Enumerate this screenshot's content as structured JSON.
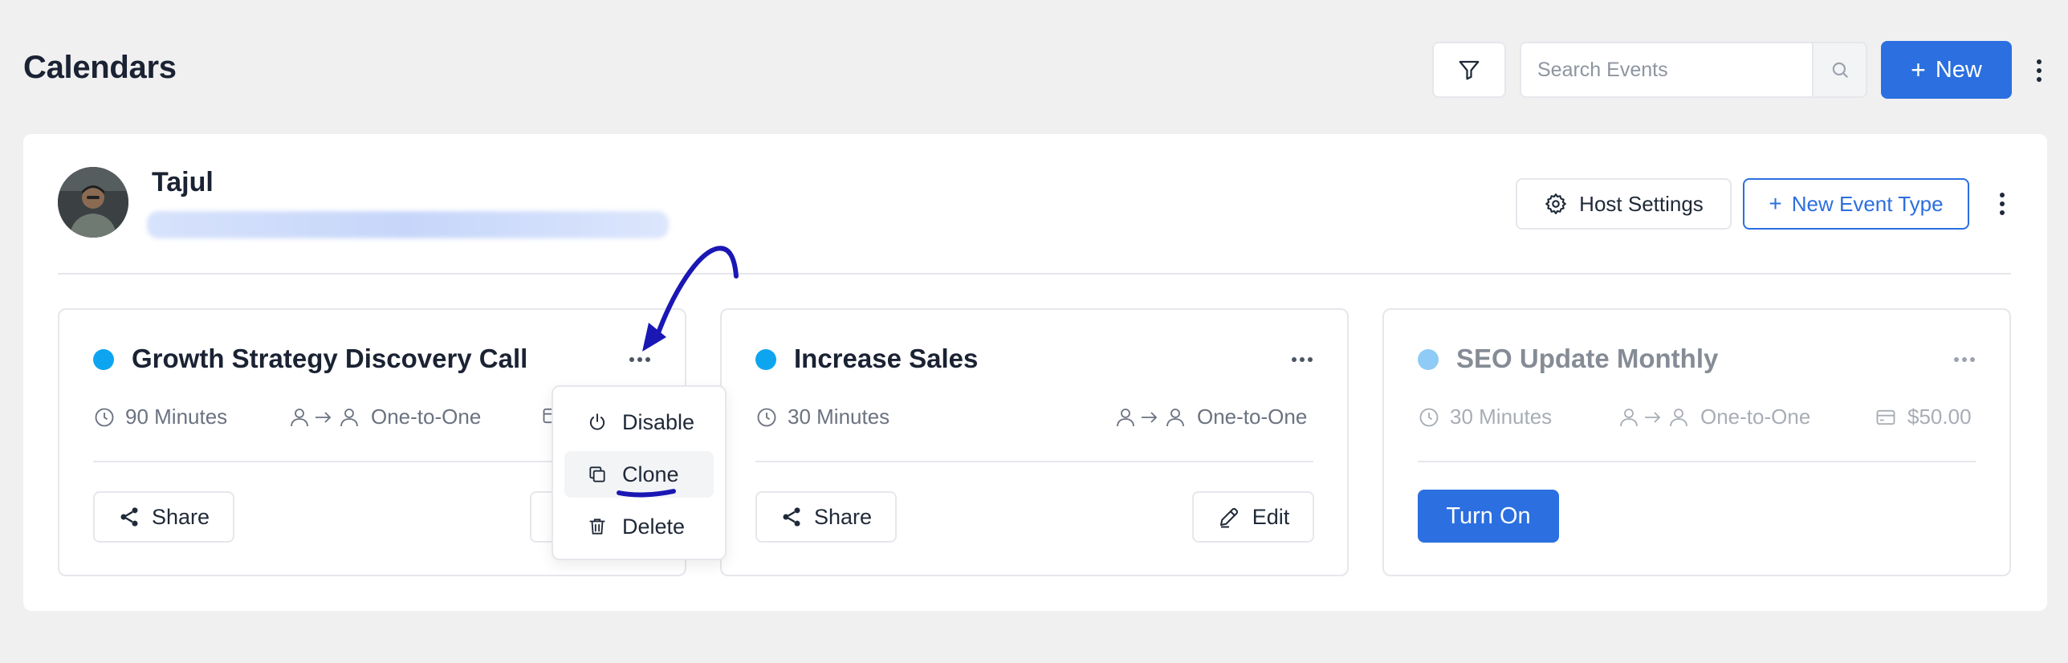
{
  "header": {
    "title": "Calendars",
    "search_placeholder": "Search Events",
    "new_label": "New"
  },
  "host": {
    "name": "Tajul",
    "email_blurred": "",
    "settings_label": "Host Settings",
    "new_event_type_label": "New Event Type"
  },
  "cards": [
    {
      "title": "Growth Strategy Discovery Call",
      "status_color": "#0ea5f0",
      "duration": "90 Minutes",
      "type": "One-to-One",
      "share_label": "Share"
    },
    {
      "title": "Increase Sales",
      "status_color": "#0ea5f0",
      "duration": "30 Minutes",
      "type": "One-to-One",
      "share_label": "Share",
      "edit_label": "Edit"
    },
    {
      "title": "SEO Update Monthly",
      "status_color": "#8ecbf6",
      "duration": "30 Minutes",
      "type": "One-to-One",
      "price": "$50.00",
      "turn_on_label": "Turn On"
    }
  ],
  "dropdown": {
    "items": [
      {
        "label": "Disable",
        "icon": "power-icon"
      },
      {
        "label": "Clone",
        "icon": "copy-icon"
      },
      {
        "label": "Delete",
        "icon": "trash-icon"
      }
    ]
  },
  "colors": {
    "accent": "#2b6fe0",
    "background": "#f0f0f1",
    "annotation": "#1a17b5"
  }
}
